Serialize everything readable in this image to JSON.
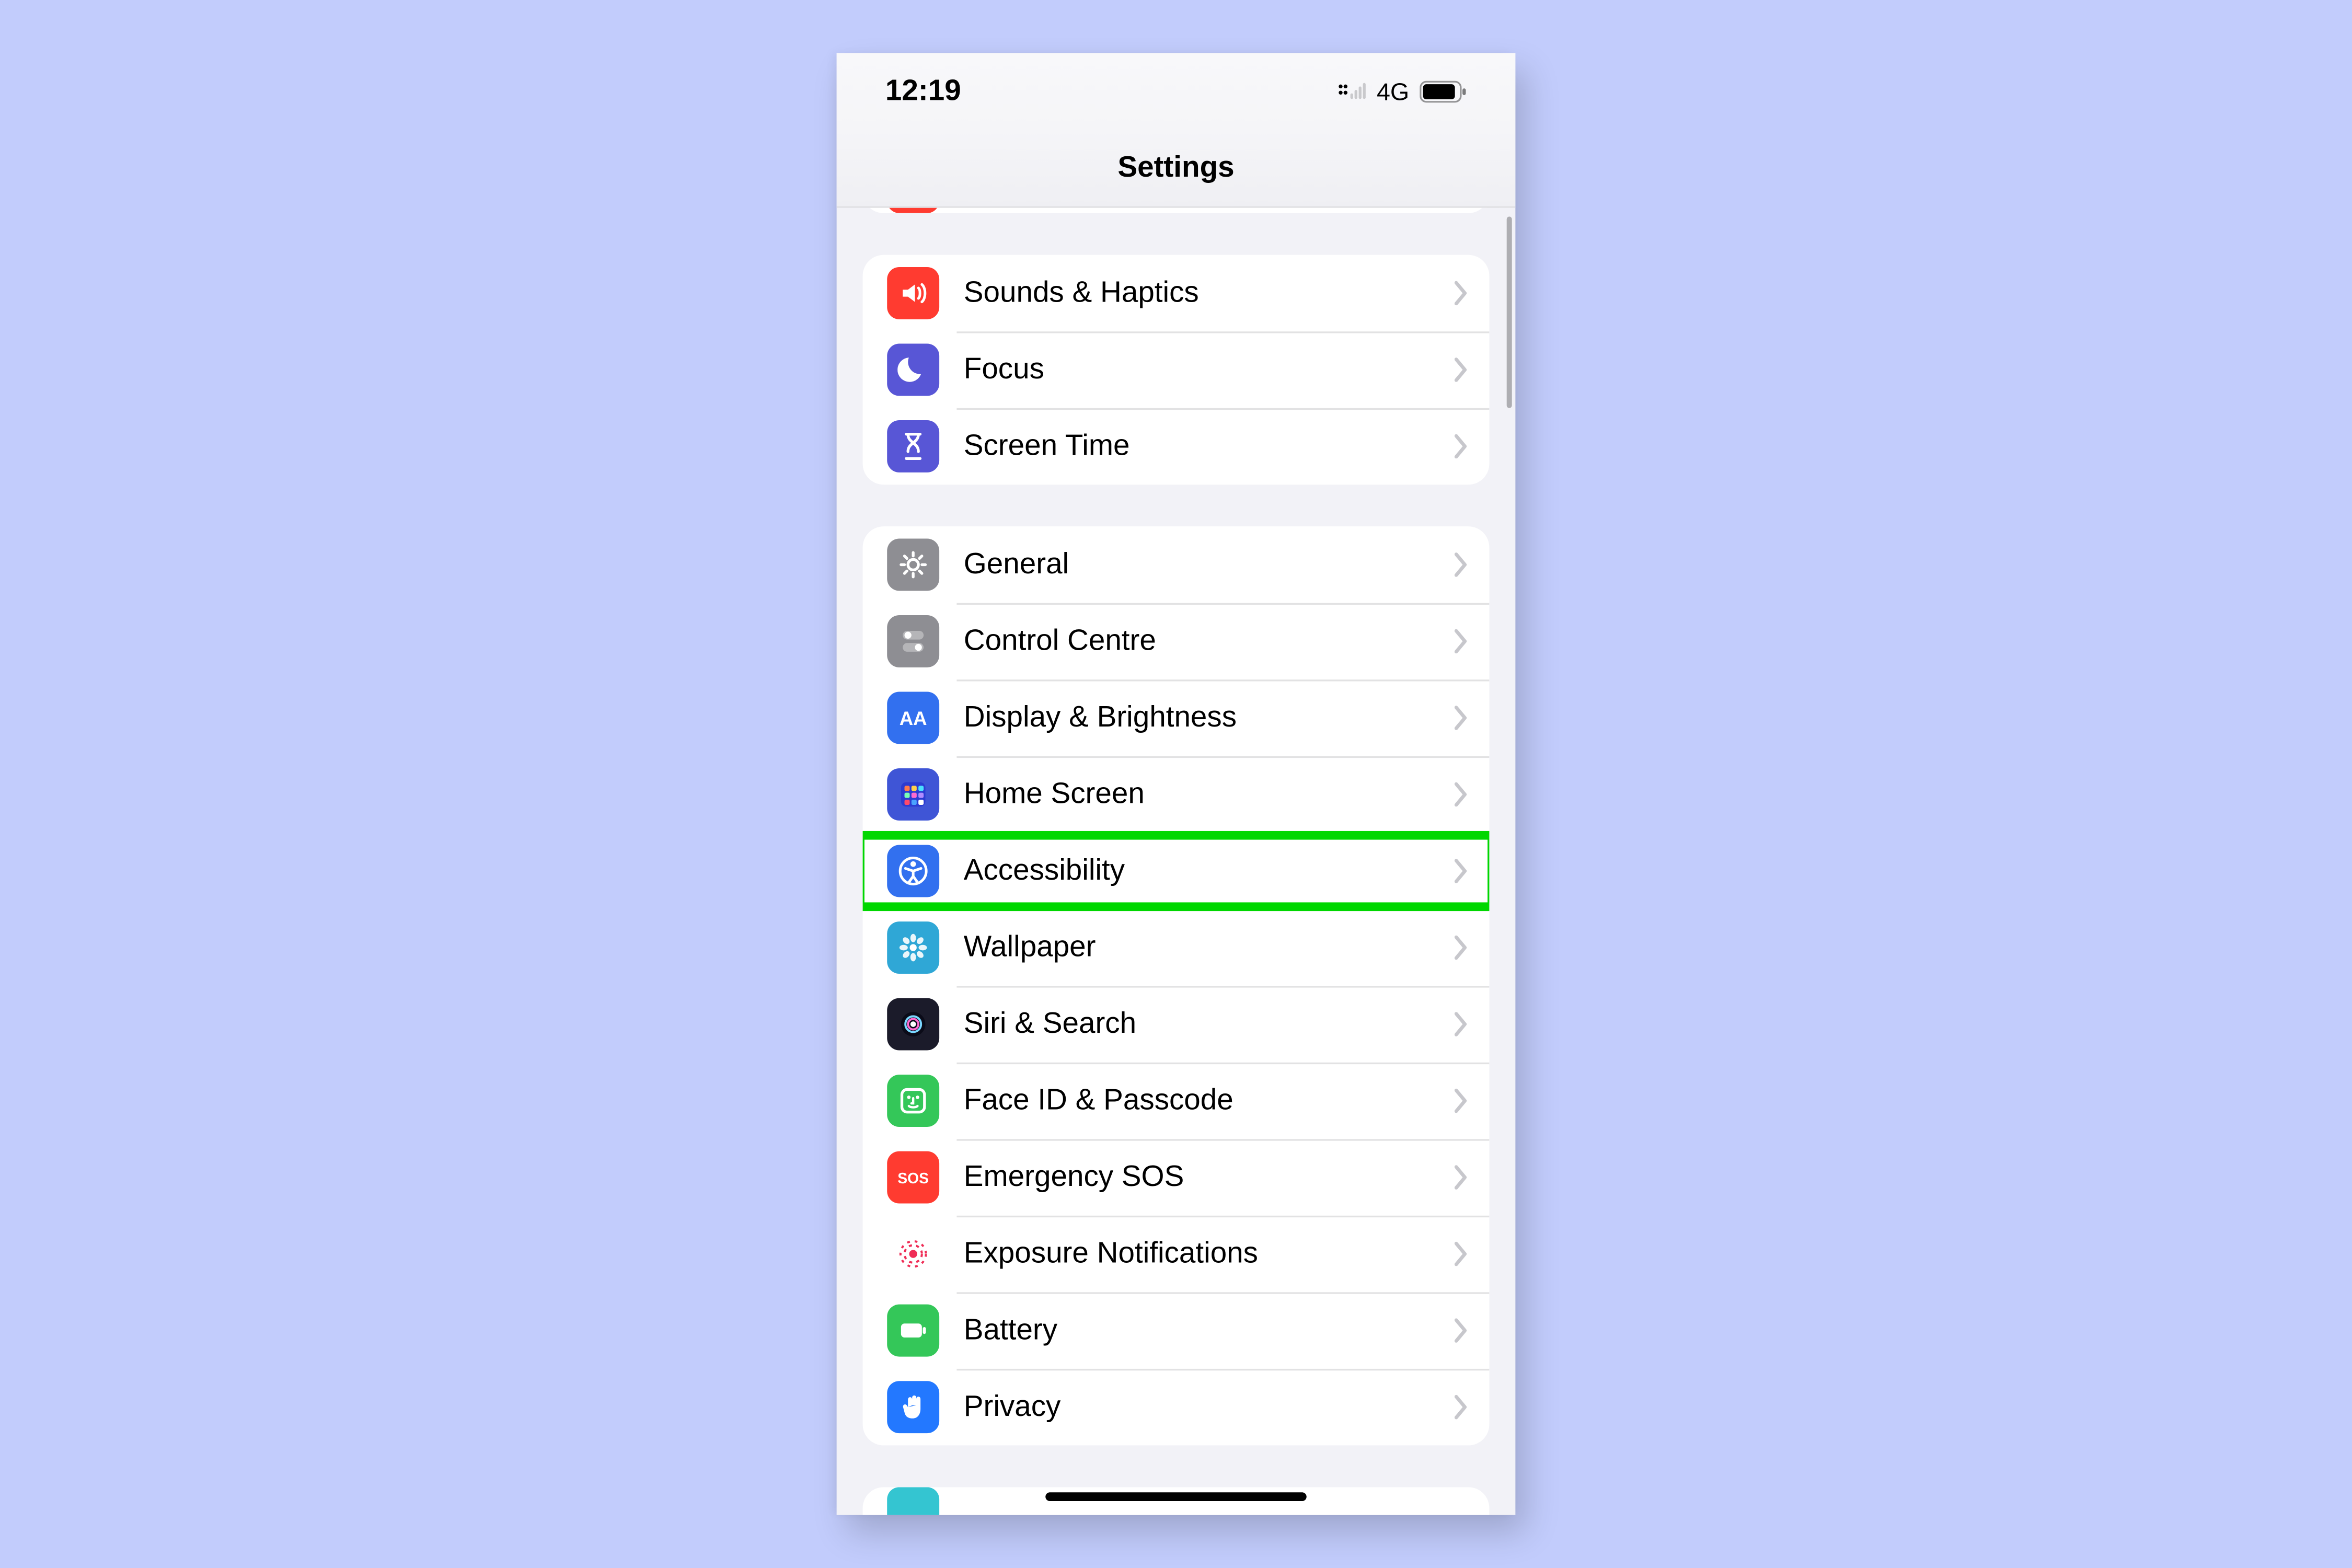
{
  "statusbar": {
    "time": "12:19",
    "network_label": "4G"
  },
  "header": {
    "title": "Settings"
  },
  "groups": [
    {
      "id": "g0-peek",
      "peek_top": true,
      "rows": [
        {
          "id": "top-peek",
          "label": "",
          "icon": "blank-red-icon",
          "bg": "c-red"
        }
      ]
    },
    {
      "id": "g1",
      "rows": [
        {
          "id": "sounds-haptics",
          "label": "Sounds & Haptics",
          "icon": "speaker-icon",
          "bg": "c-red"
        },
        {
          "id": "focus",
          "label": "Focus",
          "icon": "moon-icon",
          "bg": "c-indigo"
        },
        {
          "id": "screen-time",
          "label": "Screen Time",
          "icon": "hourglass-icon",
          "bg": "c-indigo"
        }
      ]
    },
    {
      "id": "g2",
      "rows": [
        {
          "id": "general",
          "label": "General",
          "icon": "gear-icon",
          "bg": "c-gray"
        },
        {
          "id": "control-centre",
          "label": "Control Centre",
          "icon": "switches-icon",
          "bg": "c-gray"
        },
        {
          "id": "display-brightness",
          "label": "Display & Brightness",
          "icon": "aa-icon",
          "bg": "c-blue"
        },
        {
          "id": "home-screen",
          "label": "Home Screen",
          "icon": "grid-icon",
          "bg": "c-hs"
        },
        {
          "id": "accessibility",
          "label": "Accessibility",
          "icon": "accessibility-icon",
          "bg": "c-blue",
          "highlight": true
        },
        {
          "id": "wallpaper",
          "label": "Wallpaper",
          "icon": "flower-icon",
          "bg": "c-wall"
        },
        {
          "id": "siri-search",
          "label": "Siri & Search",
          "icon": "siri-icon",
          "bg": "c-siri"
        },
        {
          "id": "face-id-passcode",
          "label": "Face ID & Passcode",
          "icon": "faceid-icon",
          "bg": "c-green"
        },
        {
          "id": "emergency-sos",
          "label": "Emergency SOS",
          "icon": "sos-icon",
          "bg": "c-sos"
        },
        {
          "id": "exposure-notifications",
          "label": "Exposure Notifications",
          "icon": "exposure-icon",
          "bg": "c-white"
        },
        {
          "id": "battery",
          "label": "Battery",
          "icon": "battery-icon",
          "bg": "c-green"
        },
        {
          "id": "privacy",
          "label": "Privacy",
          "icon": "hand-icon",
          "bg": "c-priv"
        }
      ]
    },
    {
      "id": "g3-peek",
      "rows": [
        {
          "id": "bottom-peek",
          "label": "",
          "icon": "blank-teal-icon",
          "bg": "c-turq"
        }
      ]
    }
  ]
}
